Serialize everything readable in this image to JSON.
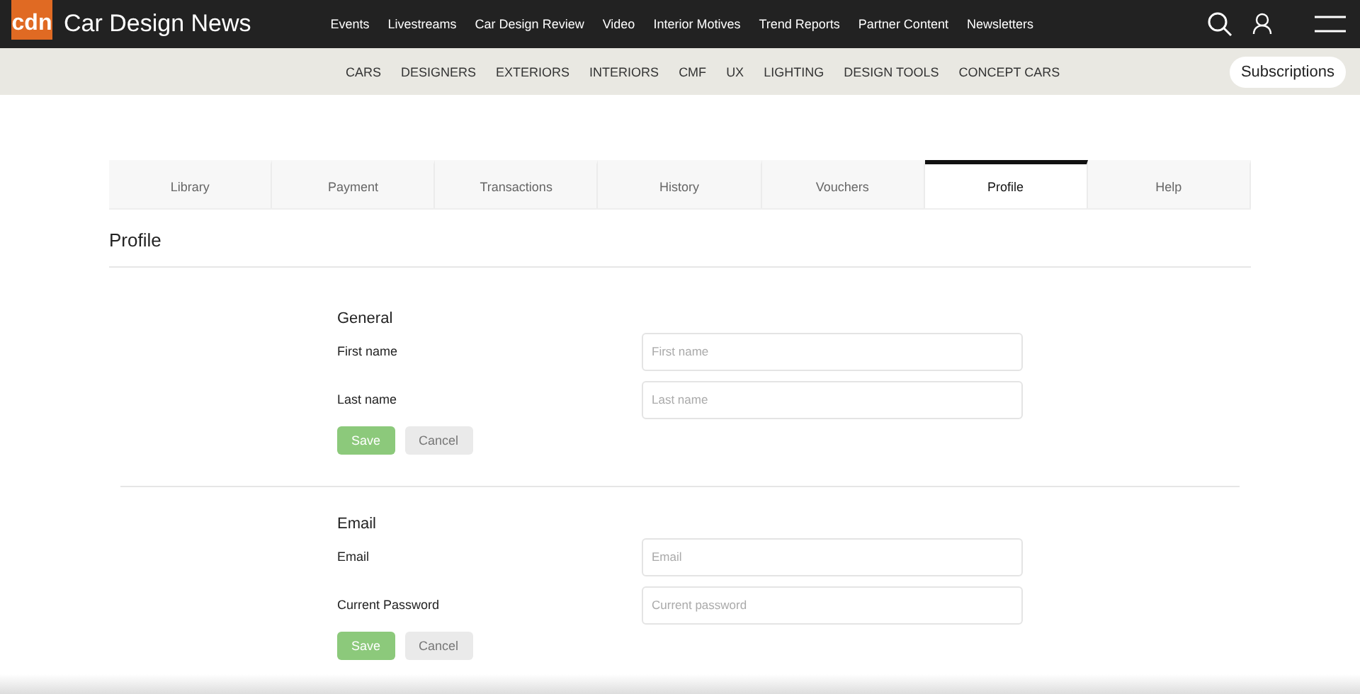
{
  "header": {
    "logo": "cdn",
    "site_name": "Car Design News",
    "nav": [
      "Events",
      "Livestreams",
      "Car Design Review",
      "Video",
      "Interior Motives",
      "Trend Reports",
      "Partner Content",
      "Newsletters"
    ]
  },
  "subnav": {
    "items": [
      "CARS",
      "DESIGNERS",
      "EXTERIORS",
      "INTERIORS",
      "CMF",
      "UX",
      "LIGHTING",
      "DESIGN TOOLS",
      "CONCEPT CARS"
    ],
    "subscriptions": "Subscriptions"
  },
  "tabs": [
    {
      "label": "Library",
      "selected": false
    },
    {
      "label": "Payment",
      "selected": false
    },
    {
      "label": "Transactions",
      "selected": false
    },
    {
      "label": "History",
      "selected": false
    },
    {
      "label": "Vouchers",
      "selected": false
    },
    {
      "label": "Profile",
      "selected": true
    },
    {
      "label": "Help",
      "selected": false
    }
  ],
  "page_title": "Profile",
  "sections": [
    {
      "title": "General",
      "fields": [
        {
          "label": "First name",
          "placeholder": "First name"
        },
        {
          "label": "Last name",
          "placeholder": "Last name"
        }
      ],
      "save": "Save",
      "cancel": "Cancel"
    },
    {
      "title": "Email",
      "fields": [
        {
          "label": "Email",
          "placeholder": "Email"
        },
        {
          "label": "Current Password",
          "placeholder": "Current password"
        }
      ],
      "save": "Save",
      "cancel": "Cancel"
    }
  ]
}
